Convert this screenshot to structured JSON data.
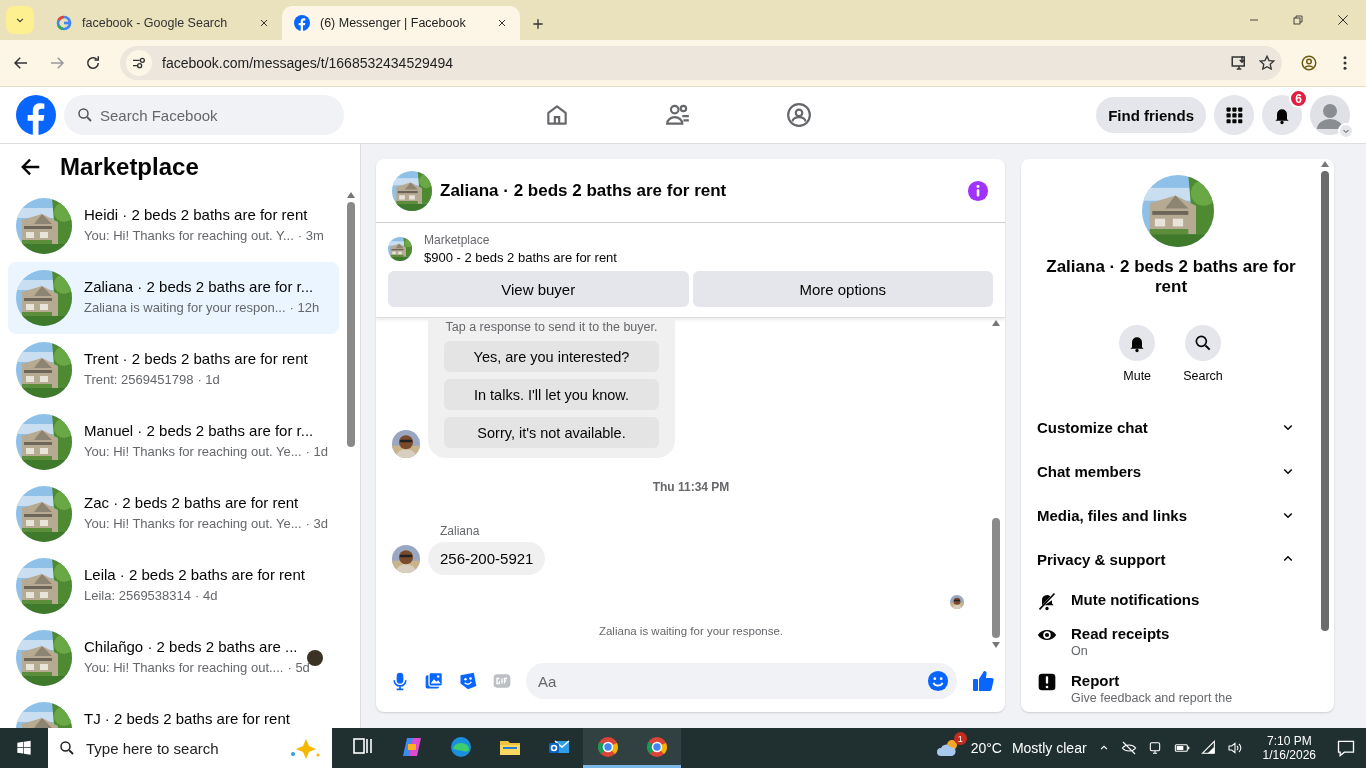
{
  "browser": {
    "tabs": [
      {
        "kind": "google",
        "title": "facebook - Google Search",
        "selected": false
      },
      {
        "kind": "facebook",
        "title": "(6) Messenger | Facebook",
        "selected": true
      }
    ],
    "url": "facebook.com/messages/t/1668532434529494"
  },
  "header": {
    "search": {
      "placeholder": "Search Facebook"
    },
    "find_friends": "Find friends",
    "notification_count": "6"
  },
  "sidebar": {
    "title": "Marketplace",
    "conversations": [
      {
        "name": "Heidi · 2 beds 2 baths are for rent",
        "preview": "You: Hi! Thanks for reaching out. Y...",
        "time": "· 3m",
        "selected": false,
        "seen": false
      },
      {
        "name": "Zaliana · 2 beds 2 baths are for r...",
        "preview": "Zaliana is waiting for your respon...",
        "time": "· 12h",
        "selected": true,
        "seen": false
      },
      {
        "name": "Trent · 2 beds 2 baths are for rent",
        "preview": "Trent: 2569451798",
        "time": "· 1d",
        "selected": false,
        "seen": false
      },
      {
        "name": "Manuel · 2 beds 2 baths are for r...",
        "preview": "You: Hi! Thanks for reaching out. Ye...",
        "time": "· 1d",
        "selected": false,
        "seen": false
      },
      {
        "name": "Zac · 2 beds 2 baths are for rent",
        "preview": "You: Hi! Thanks for reaching out. Ye...",
        "time": "· 3d",
        "selected": false,
        "seen": false
      },
      {
        "name": "Leila · 2 beds 2 baths are for rent",
        "preview": "Leila: 2569538314",
        "time": "· 4d",
        "selected": false,
        "seen": false
      },
      {
        "name": "Chilañgo · 2 beds 2 baths are ...",
        "preview": "You: Hi! Thanks for reaching out....",
        "time": "· 5d",
        "selected": false,
        "seen": true
      },
      {
        "name": "TJ · 2 beds 2 baths are for rent",
        "selected": false,
        "seen": false
      }
    ]
  },
  "chat": {
    "title": "Zaliana · 2 beds 2 baths are for rent",
    "listing": {
      "label": "Marketplace",
      "title": "$900 - 2 beds 2 baths are for rent"
    },
    "buttons": [
      "View buyer",
      "More options"
    ],
    "quick_replies": {
      "hint": "Tap a response to send it to the buyer.",
      "options": [
        "Yes, are you interested?",
        "In talks. I'll let you know.",
        "Sorry, it's not available."
      ]
    },
    "timestamp": "Thu 11:34 PM",
    "sender": "Zaliana",
    "message": "256-200-5921",
    "status": "Zaliana is waiting for your response.",
    "composer": {
      "placeholder": "Aa"
    }
  },
  "details": {
    "title": "Zaliana · 2 beds 2 baths are for rent",
    "actions": [
      {
        "kind": "bell",
        "label": "Mute"
      },
      {
        "kind": "search",
        "label": "Search"
      }
    ],
    "sections": [
      {
        "label": "Customize chat",
        "expanded": false
      },
      {
        "label": "Chat members",
        "expanded": false
      },
      {
        "label": "Media, files and links",
        "expanded": false
      },
      {
        "label": "Privacy & support",
        "expanded": true
      }
    ],
    "privacy_items": [
      {
        "kind": "mute",
        "label": "Mute notifications"
      },
      {
        "kind": "eye",
        "label": "Read receipts",
        "detail": "On"
      },
      {
        "kind": "report",
        "label": "Report",
        "detail": "Give feedback and report the"
      }
    ]
  },
  "taskbar": {
    "search_placeholder": "Type here to search",
    "apps": [
      {
        "kind": "taskview",
        "running": false
      },
      {
        "kind": "copilot",
        "running": false
      },
      {
        "kind": "edge",
        "running": false
      },
      {
        "kind": "folder",
        "running": false
      },
      {
        "kind": "outlook",
        "running": false
      },
      {
        "kind": "chrome",
        "running": true
      },
      {
        "kind": "chrome",
        "running": true
      }
    ],
    "weather": {
      "alert_count": "1",
      "temperature": "20°C",
      "condition": "Mostly clear"
    },
    "time": "7:10 PM",
    "date": "1/16/2026"
  }
}
